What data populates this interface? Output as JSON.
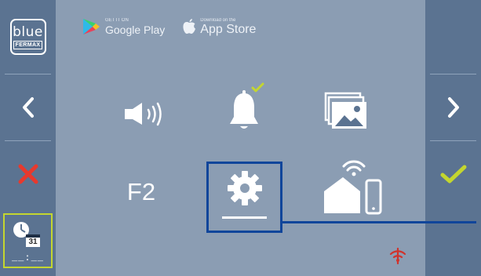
{
  "stores": {
    "google_small": "GET IT ON",
    "google_label": "Google Play",
    "apple_small": "Download on the",
    "apple_label": "App Store"
  },
  "logo": {
    "text": "blue",
    "brand": "FERMAX"
  },
  "left_column": [
    {
      "icon": "logo-icon"
    },
    {
      "icon": "chevron-left-icon"
    },
    {
      "icon": "close-icon",
      "color": "#e8392d"
    },
    {
      "icon": "calendar-clock-icon",
      "date": "31",
      "time": "__:__"
    }
  ],
  "right_column": [
    {
      "icon": "chevron-right-icon"
    },
    {
      "icon": "check-icon",
      "color": "#c4d62f"
    }
  ],
  "menu": {
    "row1": [
      "speaker-volume-icon",
      "bell-notification-icon",
      "gallery-images-icon"
    ],
    "row2": [
      "f2-label",
      "settings-gear-icon",
      "home-wifi-phone-icon"
    ],
    "f2_label": "F2",
    "selected": "settings-gear-icon"
  },
  "status": {
    "wifi_disconnected_icon": "wifi-off-icon"
  },
  "colors": {
    "background": "#8b9db3",
    "side_panel": "#5b7391",
    "accent": "#c4d62f",
    "selection": "#10459a",
    "close": "#e8392d"
  }
}
